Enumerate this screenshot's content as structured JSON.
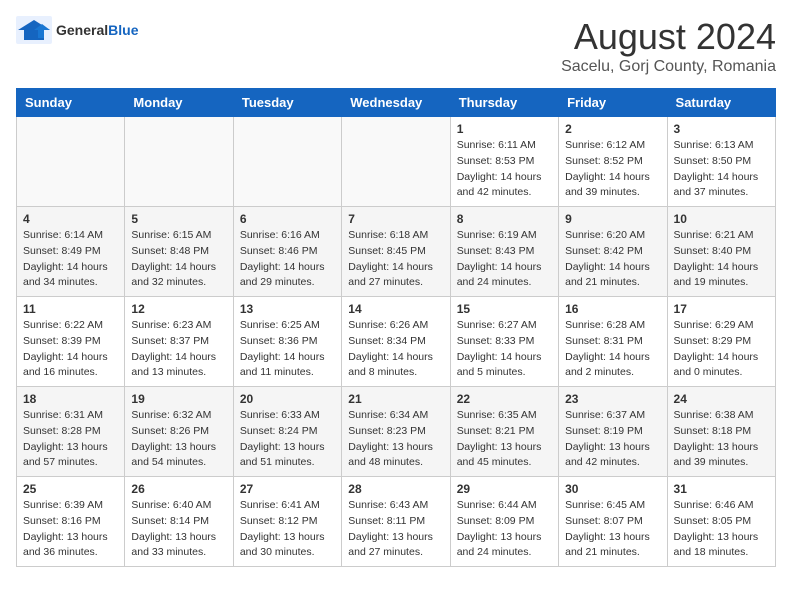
{
  "header": {
    "logo_general": "General",
    "logo_blue": "Blue",
    "main_title": "August 2024",
    "subtitle": "Sacelu, Gorj County, Romania"
  },
  "calendar": {
    "days_of_week": [
      "Sunday",
      "Monday",
      "Tuesday",
      "Wednesday",
      "Thursday",
      "Friday",
      "Saturday"
    ],
    "weeks": [
      {
        "days": [
          {
            "number": "",
            "info": ""
          },
          {
            "number": "",
            "info": ""
          },
          {
            "number": "",
            "info": ""
          },
          {
            "number": "",
            "info": ""
          },
          {
            "number": "1",
            "info": "Sunrise: 6:11 AM\nSunset: 8:53 PM\nDaylight: 14 hours and 42 minutes."
          },
          {
            "number": "2",
            "info": "Sunrise: 6:12 AM\nSunset: 8:52 PM\nDaylight: 14 hours and 39 minutes."
          },
          {
            "number": "3",
            "info": "Sunrise: 6:13 AM\nSunset: 8:50 PM\nDaylight: 14 hours and 37 minutes."
          }
        ]
      },
      {
        "days": [
          {
            "number": "4",
            "info": "Sunrise: 6:14 AM\nSunset: 8:49 PM\nDaylight: 14 hours and 34 minutes."
          },
          {
            "number": "5",
            "info": "Sunrise: 6:15 AM\nSunset: 8:48 PM\nDaylight: 14 hours and 32 minutes."
          },
          {
            "number": "6",
            "info": "Sunrise: 6:16 AM\nSunset: 8:46 PM\nDaylight: 14 hours and 29 minutes."
          },
          {
            "number": "7",
            "info": "Sunrise: 6:18 AM\nSunset: 8:45 PM\nDaylight: 14 hours and 27 minutes."
          },
          {
            "number": "8",
            "info": "Sunrise: 6:19 AM\nSunset: 8:43 PM\nDaylight: 14 hours and 24 minutes."
          },
          {
            "number": "9",
            "info": "Sunrise: 6:20 AM\nSunset: 8:42 PM\nDaylight: 14 hours and 21 minutes."
          },
          {
            "number": "10",
            "info": "Sunrise: 6:21 AM\nSunset: 8:40 PM\nDaylight: 14 hours and 19 minutes."
          }
        ]
      },
      {
        "days": [
          {
            "number": "11",
            "info": "Sunrise: 6:22 AM\nSunset: 8:39 PM\nDaylight: 14 hours and 16 minutes."
          },
          {
            "number": "12",
            "info": "Sunrise: 6:23 AM\nSunset: 8:37 PM\nDaylight: 14 hours and 13 minutes."
          },
          {
            "number": "13",
            "info": "Sunrise: 6:25 AM\nSunset: 8:36 PM\nDaylight: 14 hours and 11 minutes."
          },
          {
            "number": "14",
            "info": "Sunrise: 6:26 AM\nSunset: 8:34 PM\nDaylight: 14 hours and 8 minutes."
          },
          {
            "number": "15",
            "info": "Sunrise: 6:27 AM\nSunset: 8:33 PM\nDaylight: 14 hours and 5 minutes."
          },
          {
            "number": "16",
            "info": "Sunrise: 6:28 AM\nSunset: 8:31 PM\nDaylight: 14 hours and 2 minutes."
          },
          {
            "number": "17",
            "info": "Sunrise: 6:29 AM\nSunset: 8:29 PM\nDaylight: 14 hours and 0 minutes."
          }
        ]
      },
      {
        "days": [
          {
            "number": "18",
            "info": "Sunrise: 6:31 AM\nSunset: 8:28 PM\nDaylight: 13 hours and 57 minutes."
          },
          {
            "number": "19",
            "info": "Sunrise: 6:32 AM\nSunset: 8:26 PM\nDaylight: 13 hours and 54 minutes."
          },
          {
            "number": "20",
            "info": "Sunrise: 6:33 AM\nSunset: 8:24 PM\nDaylight: 13 hours and 51 minutes."
          },
          {
            "number": "21",
            "info": "Sunrise: 6:34 AM\nSunset: 8:23 PM\nDaylight: 13 hours and 48 minutes."
          },
          {
            "number": "22",
            "info": "Sunrise: 6:35 AM\nSunset: 8:21 PM\nDaylight: 13 hours and 45 minutes."
          },
          {
            "number": "23",
            "info": "Sunrise: 6:37 AM\nSunset: 8:19 PM\nDaylight: 13 hours and 42 minutes."
          },
          {
            "number": "24",
            "info": "Sunrise: 6:38 AM\nSunset: 8:18 PM\nDaylight: 13 hours and 39 minutes."
          }
        ]
      },
      {
        "days": [
          {
            "number": "25",
            "info": "Sunrise: 6:39 AM\nSunset: 8:16 PM\nDaylight: 13 hours and 36 minutes."
          },
          {
            "number": "26",
            "info": "Sunrise: 6:40 AM\nSunset: 8:14 PM\nDaylight: 13 hours and 33 minutes."
          },
          {
            "number": "27",
            "info": "Sunrise: 6:41 AM\nSunset: 8:12 PM\nDaylight: 13 hours and 30 minutes."
          },
          {
            "number": "28",
            "info": "Sunrise: 6:43 AM\nSunset: 8:11 PM\nDaylight: 13 hours and 27 minutes."
          },
          {
            "number": "29",
            "info": "Sunrise: 6:44 AM\nSunset: 8:09 PM\nDaylight: 13 hours and 24 minutes."
          },
          {
            "number": "30",
            "info": "Sunrise: 6:45 AM\nSunset: 8:07 PM\nDaylight: 13 hours and 21 minutes."
          },
          {
            "number": "31",
            "info": "Sunrise: 6:46 AM\nSunset: 8:05 PM\nDaylight: 13 hours and 18 minutes."
          }
        ]
      }
    ]
  }
}
